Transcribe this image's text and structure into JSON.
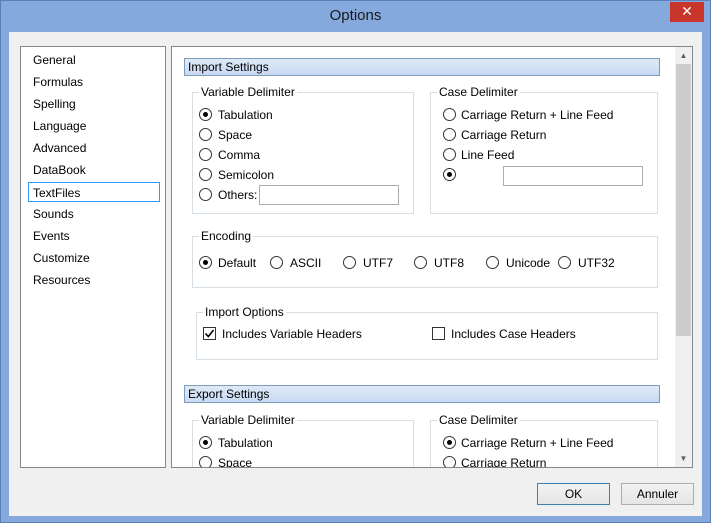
{
  "window": {
    "title": "Options",
    "close_glyph": "✕"
  },
  "nav": {
    "items": [
      {
        "label": "General"
      },
      {
        "label": "Formulas"
      },
      {
        "label": "Spelling"
      },
      {
        "label": "Language"
      },
      {
        "label": "Advanced"
      },
      {
        "label": "DataBook"
      },
      {
        "label": "TextFiles",
        "selected": true
      },
      {
        "label": "Sounds"
      },
      {
        "label": "Events"
      },
      {
        "label": "Customize"
      },
      {
        "label": "Resources"
      }
    ]
  },
  "import_settings": {
    "header": "Import Settings",
    "variable_delimiter": {
      "title": "Variable Delimiter",
      "options": [
        "Tabulation",
        "Space",
        "Comma",
        "Semicolon",
        "Others:"
      ],
      "selected": "Tabulation",
      "others_value": ""
    },
    "case_delimiter": {
      "title": "Case Delimiter",
      "options": [
        "Carriage Return + Line Feed",
        "Carriage Return",
        "Line Feed",
        ""
      ],
      "selected_index": 3,
      "custom_value": ""
    },
    "encoding": {
      "title": "Encoding",
      "options": [
        "Default",
        "ASCII",
        "UTF7",
        "UTF8",
        "Unicode",
        "UTF32"
      ],
      "selected": "Default"
    },
    "import_options": {
      "title": "Import Options",
      "includes_variable_headers": {
        "label": "Includes Variable Headers",
        "checked": true
      },
      "includes_case_headers": {
        "label": "Includes Case Headers",
        "checked": false
      }
    }
  },
  "export_settings": {
    "header": "Export Settings",
    "variable_delimiter": {
      "title": "Variable Delimiter",
      "options": [
        "Tabulation",
        "Space"
      ],
      "selected": "Tabulation"
    },
    "case_delimiter": {
      "title": "Case Delimiter",
      "options": [
        "Carriage Return + Line Feed",
        "Carriage Return"
      ],
      "selected_index": 0
    }
  },
  "scrollbar": {
    "up_glyph": "▲",
    "down_glyph": "▼"
  },
  "buttons": {
    "ok": "OK",
    "cancel": "Annuler"
  }
}
